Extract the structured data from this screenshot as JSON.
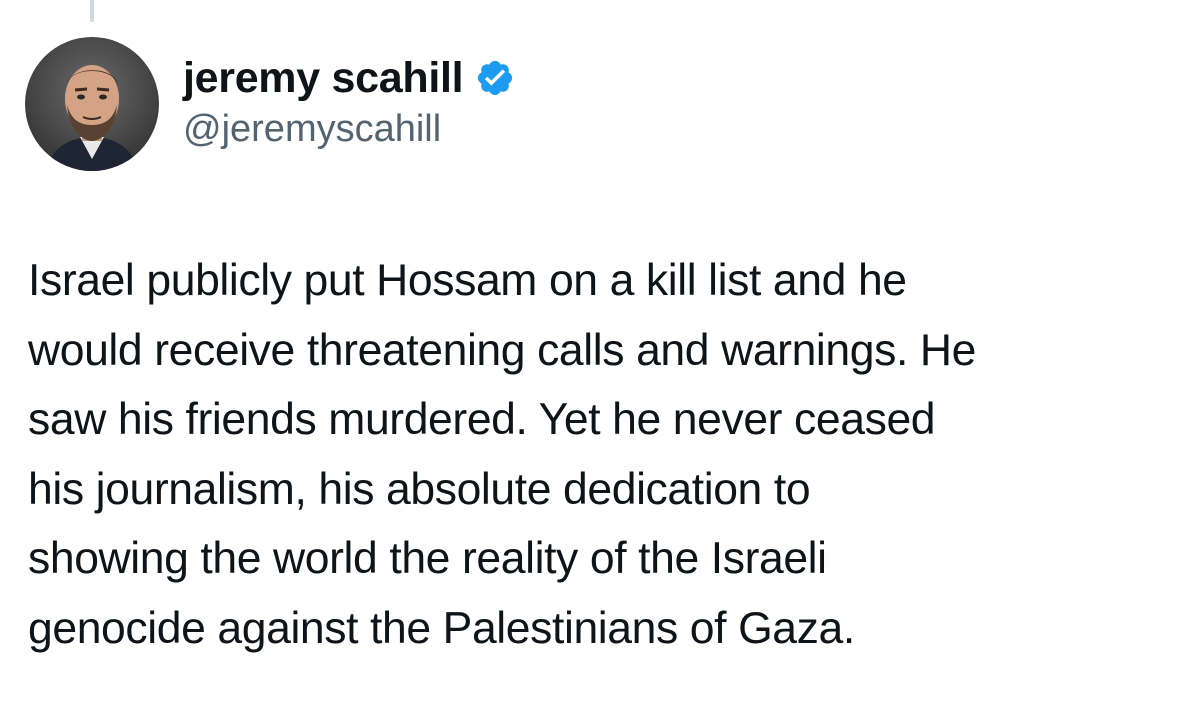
{
  "author": {
    "display_name": "jeremy scahill",
    "handle": "@jeremyscahill",
    "verified": true,
    "verified_color": "#1d9bf0",
    "avatar_icon": "profile-photo"
  },
  "tweet": {
    "lines": [
      "Israel publicly put Hossam on a kill list and he",
      "would receive threatening calls and warnings. He",
      "saw his friends murdered. Yet he never ceased",
      "his journalism, his absolute dedication to",
      "showing the world the reality of the Israeli",
      "genocide against the Palestinians of Gaza."
    ]
  },
  "colors": {
    "text": "#0f1419",
    "secondary_text": "#536471",
    "thread_line": "#cfd9de",
    "background": "#ffffff"
  }
}
